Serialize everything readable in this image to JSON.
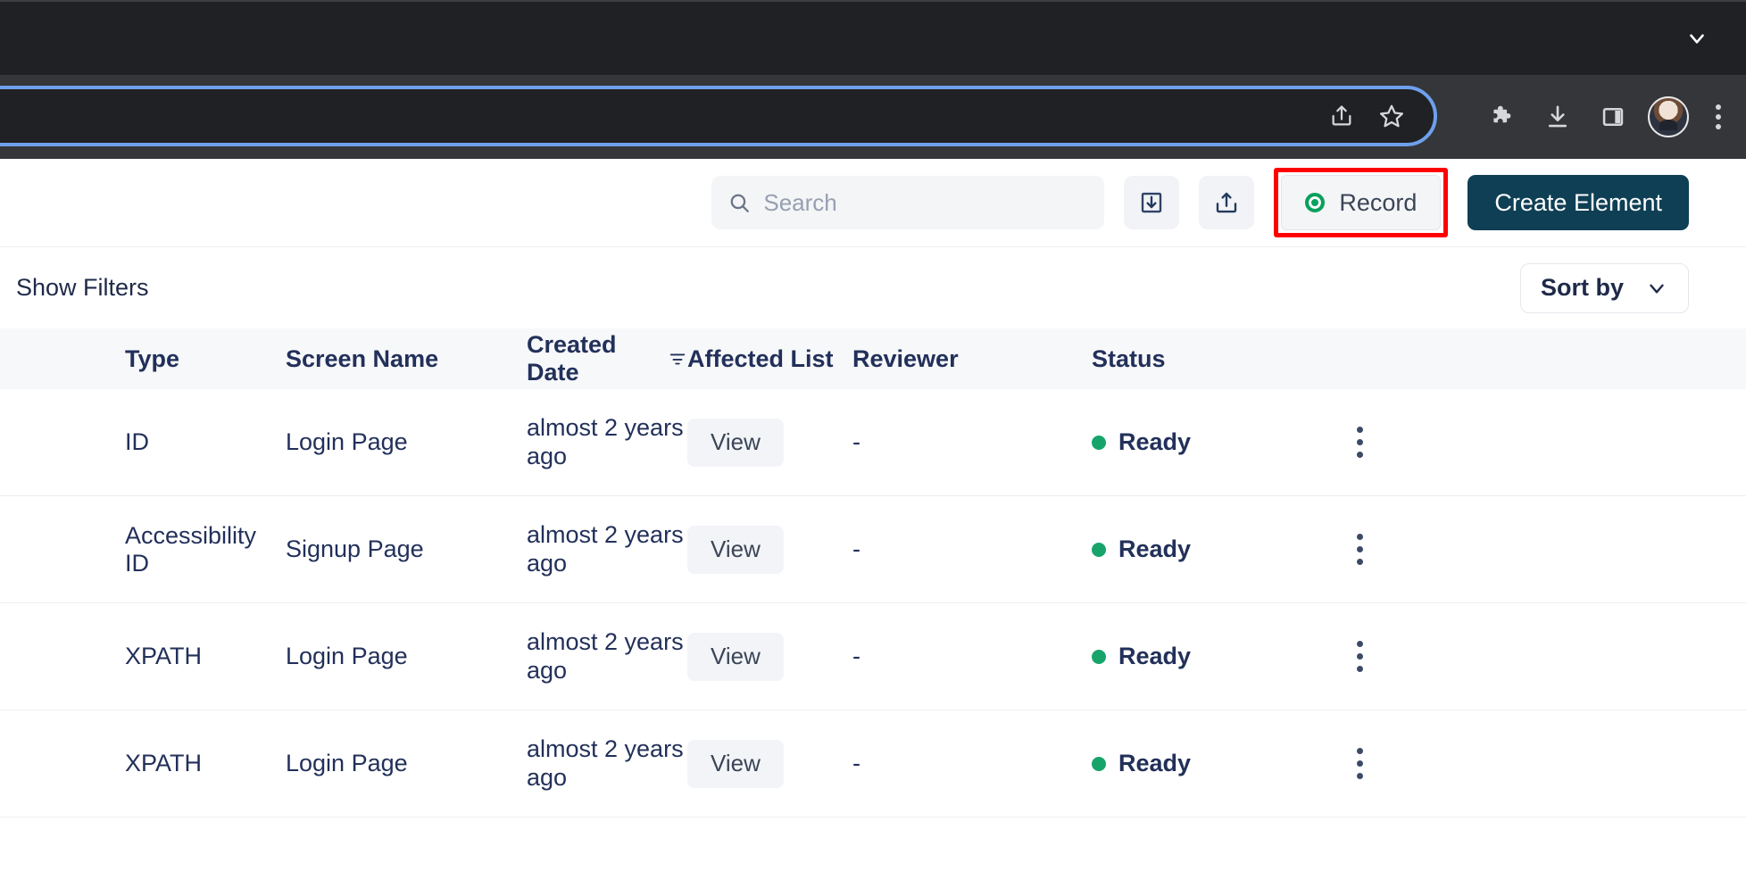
{
  "browser": {
    "tabstrip": {
      "collapse_icon": "chevron-down-icon"
    },
    "omnibox": {
      "value": "",
      "placeholder": ""
    },
    "icons": {
      "share": "share-icon",
      "bookmark": "star-icon",
      "extensions": "puzzle-icon",
      "downloads": "download-icon",
      "side_panel": "side-panel-icon",
      "profile": "avatar",
      "menu": "three-dot-menu-icon"
    }
  },
  "app_header": {
    "search": {
      "value": "",
      "placeholder": "Search"
    },
    "import_button": {
      "icon": "import-icon",
      "label": ""
    },
    "export_button": {
      "icon": "export-icon",
      "label": ""
    },
    "record_button": {
      "label": "Record",
      "dot_color": "#08a05c",
      "highlight_color": "#ff0000"
    },
    "create_button": {
      "label": "Create Element",
      "bg_color": "#0f3f54"
    }
  },
  "filter_bar": {
    "show_filters_label": "Show Filters",
    "sort_by_label": "Sort by",
    "sort_by_icon": "chevron-down-icon"
  },
  "table": {
    "columns": [
      {
        "label": "Type"
      },
      {
        "label": "Screen Name"
      },
      {
        "label": "Created Date",
        "icon": "sort-filter-icon"
      },
      {
        "label": "Affected List"
      },
      {
        "label": "Reviewer"
      },
      {
        "label": "Status"
      }
    ],
    "rows": [
      {
        "type": "ID",
        "screen_name": "Login Page",
        "created_date": "almost 2 years ago",
        "affected_list_label": "View",
        "reviewer": "-",
        "status": "Ready",
        "status_color": "#16a46a"
      },
      {
        "type": "Accessibility ID",
        "screen_name": "Signup Page",
        "created_date": "almost 2 years ago",
        "affected_list_label": "View",
        "reviewer": "-",
        "status": "Ready",
        "status_color": "#16a46a"
      },
      {
        "type": "XPATH",
        "screen_name": "Login Page",
        "created_date": "almost 2 years ago",
        "affected_list_label": "View",
        "reviewer": "-",
        "status": "Ready",
        "status_color": "#16a46a"
      },
      {
        "type": "XPATH",
        "screen_name": "Login Page",
        "created_date": "almost 2 years ago",
        "affected_list_label": "View",
        "reviewer": "-",
        "status": "Ready",
        "status_color": "#16a46a"
      }
    ]
  }
}
